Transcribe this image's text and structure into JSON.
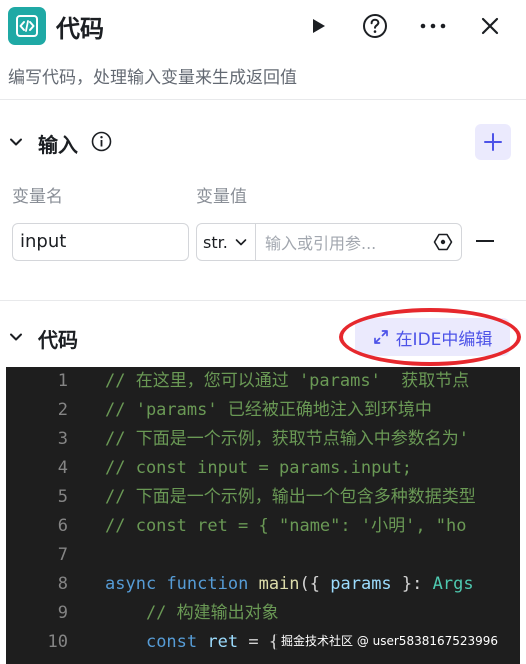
{
  "header": {
    "title": "代码",
    "icon": "code-icon",
    "buttons": [
      "run-icon",
      "help-icon",
      "more-icon",
      "close-icon"
    ]
  },
  "description": "编写代码，处理输入变量来生成返回值",
  "input_section": {
    "title": "输入",
    "columns": {
      "name": "变量名",
      "value": "变量值"
    },
    "row": {
      "name": "input",
      "type": "str.",
      "value_placeholder": "输入或引用参..."
    }
  },
  "code_section": {
    "title": "代码",
    "ide_button": "在IDE中编辑"
  },
  "code_lines": [
    {
      "n": "1",
      "segs": [
        {
          "c": "c-com",
          "t": "// 在这里，您可以通过 'params'  获取节点"
        }
      ]
    },
    {
      "n": "2",
      "segs": [
        {
          "c": "c-com",
          "t": "// 'params' 已经被正确地注入到环境中"
        }
      ]
    },
    {
      "n": "3",
      "segs": [
        {
          "c": "c-com",
          "t": "// 下面是一个示例，获取节点输入中参数名为'"
        }
      ]
    },
    {
      "n": "4",
      "segs": [
        {
          "c": "c-com",
          "t": "// const input = params.input;"
        }
      ]
    },
    {
      "n": "5",
      "segs": [
        {
          "c": "c-com",
          "t": "// 下面是一个示例，输出一个包含多种数据类型"
        }
      ]
    },
    {
      "n": "6",
      "segs": [
        {
          "c": "c-com",
          "t": "// const ret = { \"name\": '小明', \"ho"
        }
      ]
    },
    {
      "n": "7",
      "segs": []
    },
    {
      "n": "8",
      "segs": [
        {
          "c": "c-kw",
          "t": "async"
        },
        {
          "c": "c-plain",
          "t": " "
        },
        {
          "c": "c-kw",
          "t": "function"
        },
        {
          "c": "c-plain",
          "t": " "
        },
        {
          "c": "c-fn",
          "t": "main"
        },
        {
          "c": "c-plain",
          "t": "({ "
        },
        {
          "c": "c-var",
          "t": "params"
        },
        {
          "c": "c-plain",
          "t": " }: "
        },
        {
          "c": "c-type",
          "t": "Args"
        }
      ]
    },
    {
      "n": "9",
      "segs": [
        {
          "c": "c-com",
          "t": "    // 构建输出对象"
        }
      ]
    },
    {
      "n": "10",
      "segs": [
        {
          "c": "c-plain",
          "t": "    "
        },
        {
          "c": "c-kw",
          "t": "const"
        },
        {
          "c": "c-plain",
          "t": " "
        },
        {
          "c": "c-var",
          "t": "ret"
        },
        {
          "c": "c-plain",
          "t": " = {"
        }
      ]
    }
  ],
  "watermark": "掘金技术社区 @ user5838167523996",
  "colors": {
    "accent": "#4d53e8",
    "logo_bg": "#1fa9a5",
    "highlight_circle": "#e6282d",
    "editor_bg": "#1e1e1e"
  }
}
